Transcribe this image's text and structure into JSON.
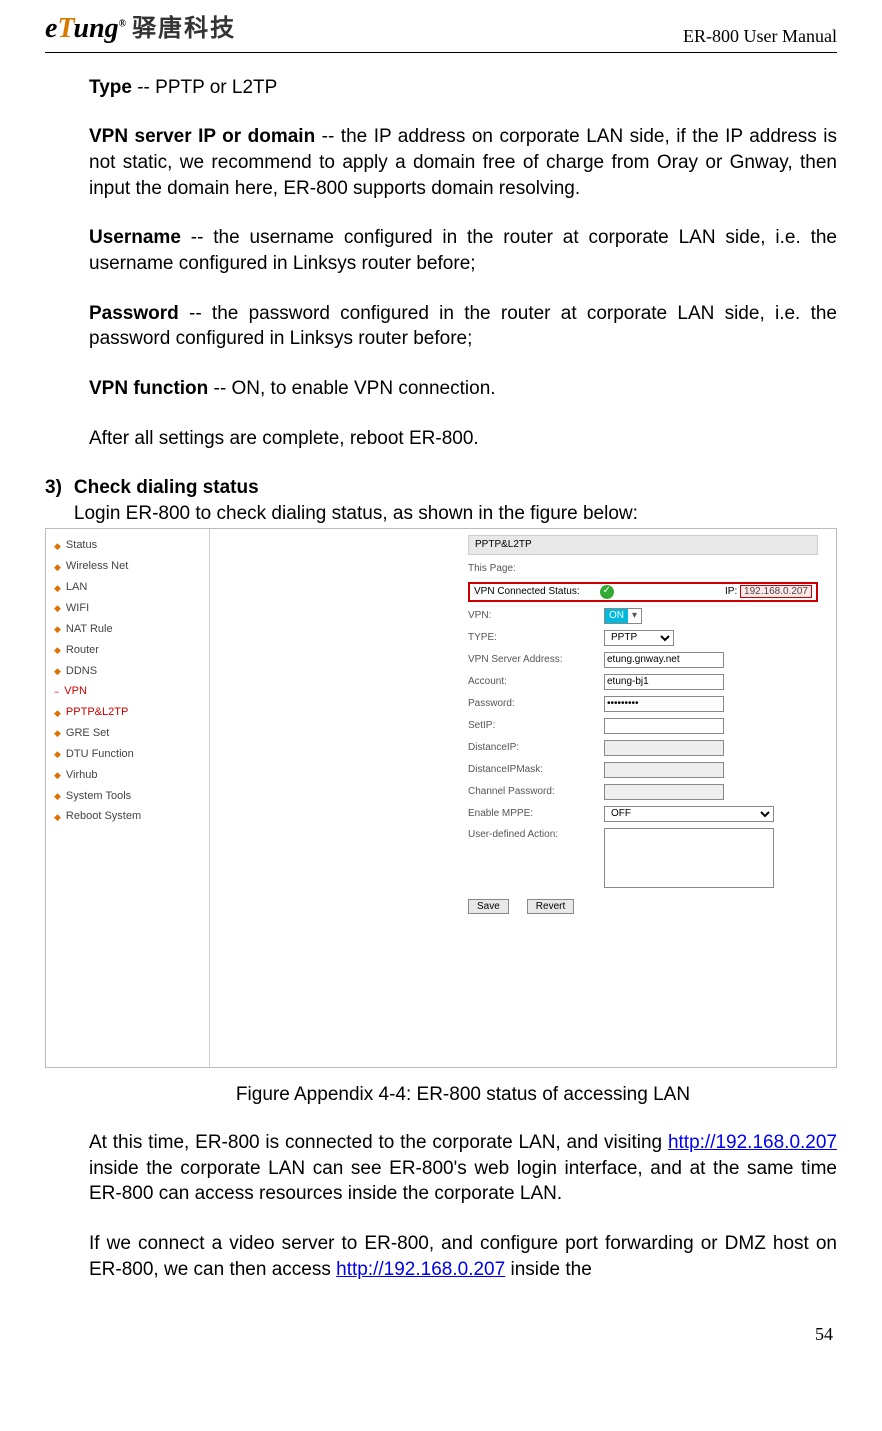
{
  "header": {
    "logo_text": "eTung",
    "logo_cn": "驿唐科技",
    "manual_title": "ER-800 User Manual"
  },
  "body": {
    "type_label": "Type",
    "type_text": " -- PPTP or L2TP",
    "vpn_ip_label": "VPN server IP or domain",
    "vpn_ip_text": " -- the IP address on corporate LAN side, if the IP address is not static, we recommend to apply a domain free of charge from Oray or Gnway, then input the domain here, ER-800 supports domain resolving.",
    "username_label": "Username",
    "username_text": " -- the username configured in the router at corporate LAN side, i.e. the username configured in Linksys router before;",
    "password_label": "Password",
    "password_text": " -- the password configured in the router at corporate LAN side, i.e. the password configured in Linksys router before;",
    "vpnfn_label": "VPN function",
    "vpnfn_text": " -- ON, to enable VPN connection.",
    "after_settings": "After all settings are complete, reboot ER-800.",
    "step3_num": "3)",
    "step3_title": "Check dialing status",
    "step3_intro": "Login ER-800 to check dialing status, as shown in the figure below:",
    "figure_caption": "Figure Appendix 4-4: ER-800 status of accessing LAN",
    "para_after_fig_1a": "At this time, ER-800 is connected to the corporate LAN, and visiting ",
    "link1": "http://192.168.0.207",
    "para_after_fig_1b": " inside the corporate LAN can see ER-800's web login interface, and at the same time ER-800 can access resources inside the corporate LAN.",
    "para_after_fig_2a": "If we connect a video server to ER-800, and configure port forwarding or DMZ host on ER-800, we can then access ",
    "link2": "http://192.168.0.207",
    "para_after_fig_2b": " inside the"
  },
  "embedded": {
    "nav": [
      "Status",
      "Wireless Net",
      "LAN",
      "WIFI",
      "NAT Rule",
      "Router",
      "DDNS"
    ],
    "nav_vpn": "VPN",
    "nav_sub1": "PPTP&L2TP",
    "nav_sub2": "GRE Set",
    "nav_after": [
      "DTU Function",
      "Virhub",
      "System Tools",
      "Reboot System"
    ],
    "panel_title": "PPTP&L2TP",
    "this_page": "This Page:",
    "status_label": "VPN Connected Status:",
    "ip_label": "IP:",
    "ip_value": "192.168.0.207",
    "vpn_label": "VPN:",
    "vpn_value": "ON",
    "type_label": "TYPE:",
    "type_value": "PPTP",
    "server_label": "VPN Server Address:",
    "server_value": "etung.gnway.net",
    "account_label": "Account:",
    "account_value": "etung-bj1",
    "password_label": "Password:",
    "password_value": "•••••••••",
    "setip_label": "SetIP:",
    "distip_label": "DistanceIP:",
    "distmask_label": "DistanceIPMask:",
    "chanpw_label": "Channel Password:",
    "mppe_label": "Enable MPPE:",
    "mppe_value": "OFF",
    "userdef_label": "User-defined Action:",
    "save_btn": "Save",
    "revert_btn": "Revert"
  },
  "footer": {
    "page_num": "54"
  }
}
